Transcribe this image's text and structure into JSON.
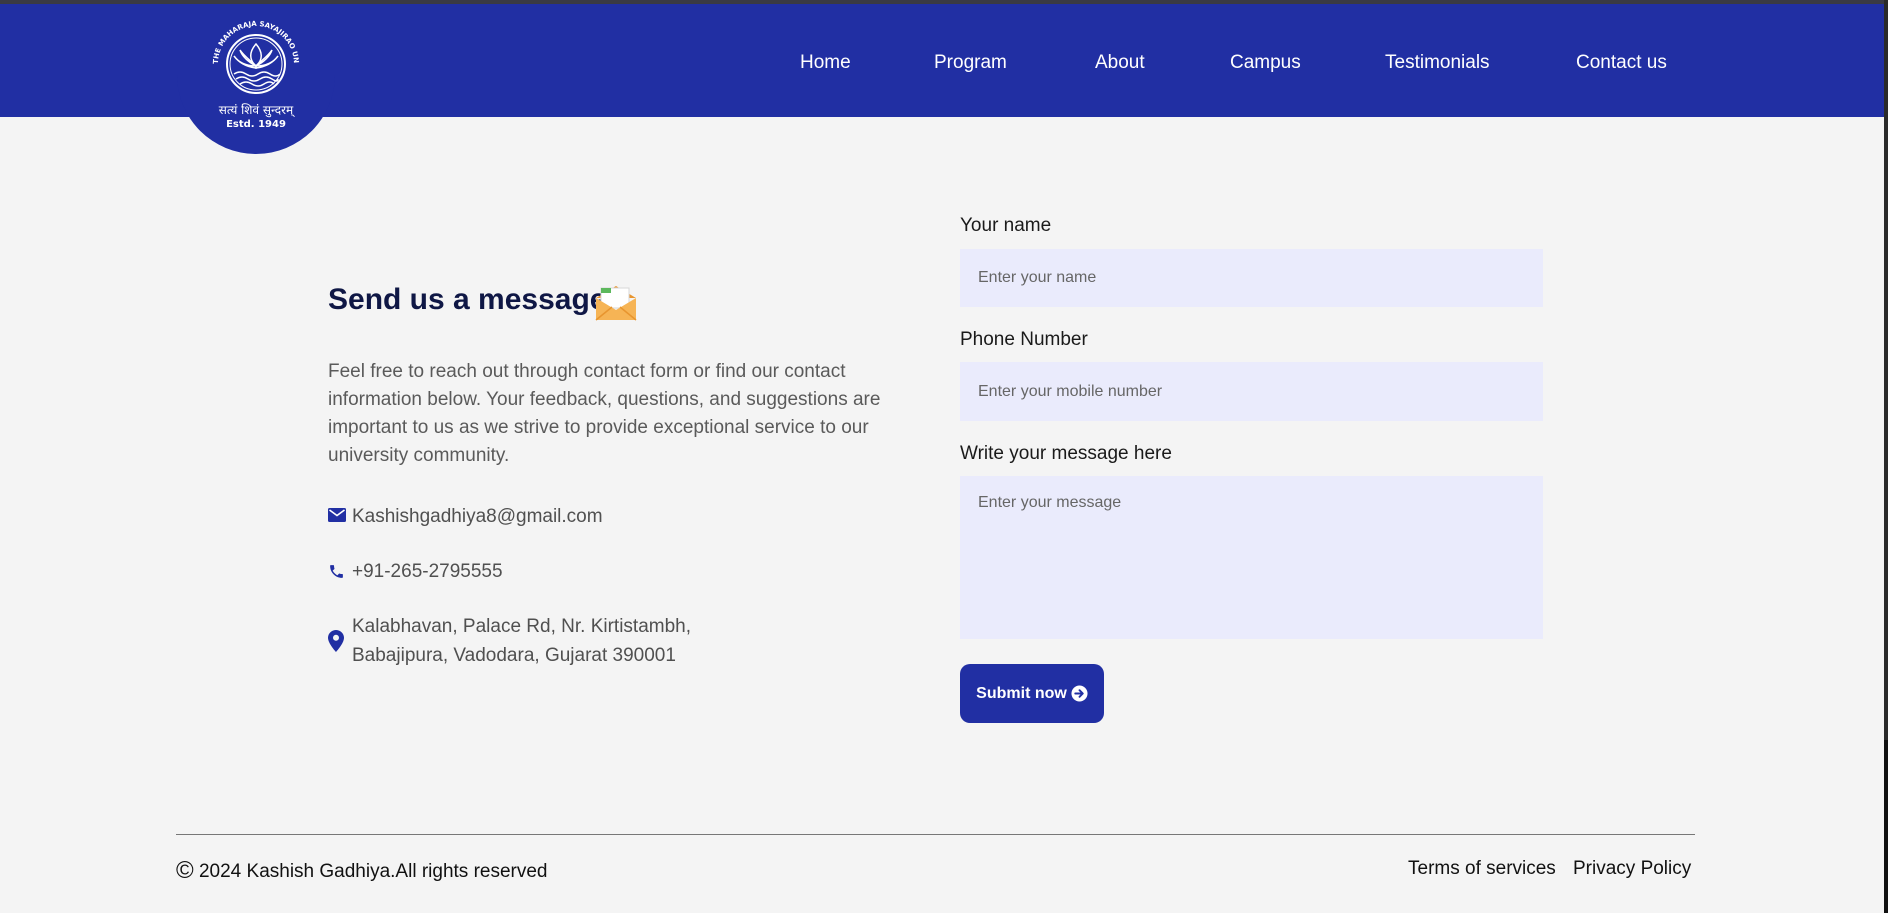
{
  "colors": {
    "brand": "#212fa3",
    "field_bg": "#eaebfc",
    "page_bg": "#f4f4f4",
    "heading": "#0f1745"
  },
  "header": {
    "logo": {
      "seal_text": "THE MAHARAJA SAYAJIRAO UNIVERSITY OF BARODA",
      "motto": "सत्यं शिवं सुन्दरम्",
      "estd": "Estd. 1949"
    },
    "nav": [
      {
        "label": "Home"
      },
      {
        "label": "Program"
      },
      {
        "label": "About"
      },
      {
        "label": "Campus"
      },
      {
        "label": "Testimonials"
      },
      {
        "label": "Contact us"
      }
    ]
  },
  "contact": {
    "heading": "Send us a message",
    "heading_icon": "envelope-icon",
    "intro": "Feel free to reach out through contact form or find our contact information below. Your feedback, questions, and suggestions are important to us as we strive to provide exceptional service to our university community.",
    "email": {
      "icon": "mail-icon",
      "text": "Kashishgadhiya8@gmail.com"
    },
    "phone": {
      "icon": "phone-icon",
      "text": "+91-265-2795555"
    },
    "address": {
      "icon": "location-pin-icon",
      "line1": "Kalabhavan, Palace Rd, Nr. Kirtistambh,",
      "line2": "Babajipura, Vadodara, Gujarat 390001"
    }
  },
  "form": {
    "name_label": "Your name",
    "name_placeholder": "Enter your name",
    "name_value": "",
    "phone_label": "Phone Number",
    "phone_placeholder": "Enter your mobile number",
    "phone_value": "",
    "message_label": "Write your message here",
    "message_placeholder": "Enter your message",
    "message_value": "",
    "submit_label": "Submit now",
    "submit_icon": "arrow-right-circle-icon"
  },
  "footer": {
    "copyright_symbol": "©",
    "copyright": "2024 Kashish Gadhiya.All rights reserved",
    "links": [
      {
        "label": "Terms of services"
      },
      {
        "label": "Privacy Policy"
      }
    ]
  }
}
